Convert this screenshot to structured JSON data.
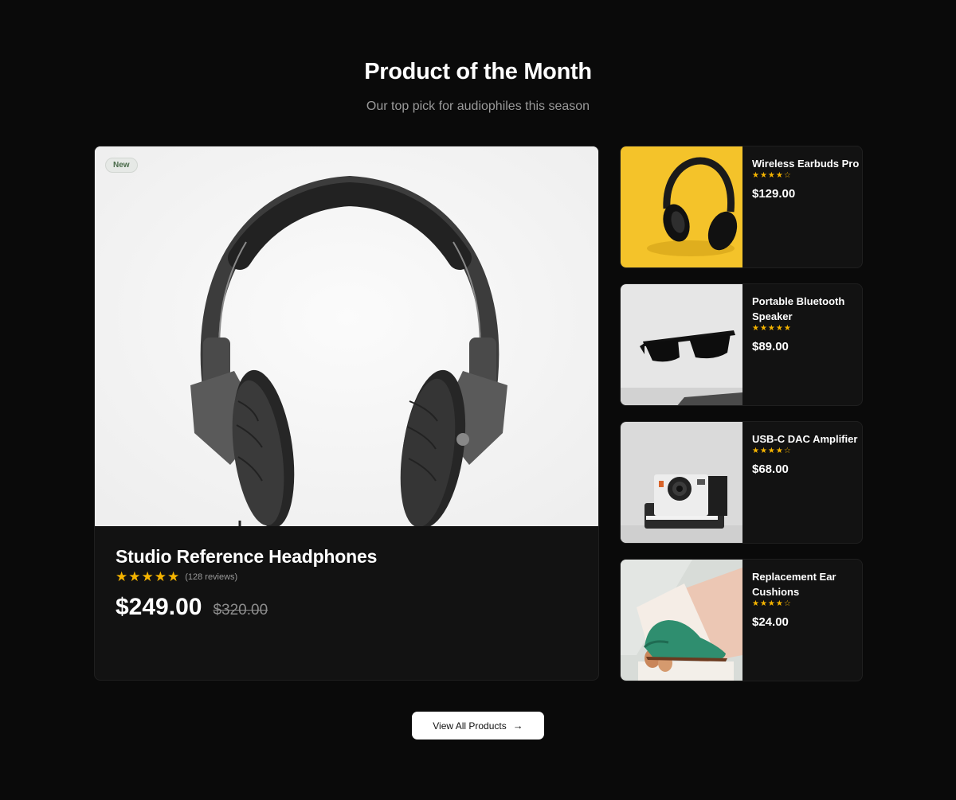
{
  "header": {
    "title": "Product of the Month",
    "subtitle": "Our top pick for audiophiles this season"
  },
  "featured": {
    "badge": "New",
    "name": "Studio Reference Headphones",
    "stars": "★★★★★",
    "rating": 5,
    "reviews": "(128 reviews)",
    "price": "$249.00",
    "old_price": "$320.00",
    "image_icon": "headphones-photo"
  },
  "products": [
    {
      "name": "Wireless Earbuds Pro",
      "stars": "★★★★☆",
      "rating": 4,
      "price": "$129.00",
      "image_icon": "headphones-on-yellow-photo"
    },
    {
      "name": "Portable Bluetooth Speaker",
      "stars": "★★★★★",
      "rating": 5,
      "price": "$89.00",
      "image_icon": "sunglasses-photo"
    },
    {
      "name": "USB-C DAC Amplifier",
      "stars": "★★★★☆",
      "rating": 4,
      "price": "$68.00",
      "image_icon": "instant-camera-photo"
    },
    {
      "name": "Replacement Ear Cushions",
      "stars": "★★★★☆",
      "rating": 4,
      "price": "$24.00",
      "image_icon": "green-shoe-photo"
    }
  ],
  "cta": {
    "label": "View All Products",
    "icon": "arrow-right-icon"
  },
  "colors": {
    "background": "#0a0a0a",
    "card": "#121212",
    "star": "#f5b400",
    "button": "#ffffff"
  }
}
